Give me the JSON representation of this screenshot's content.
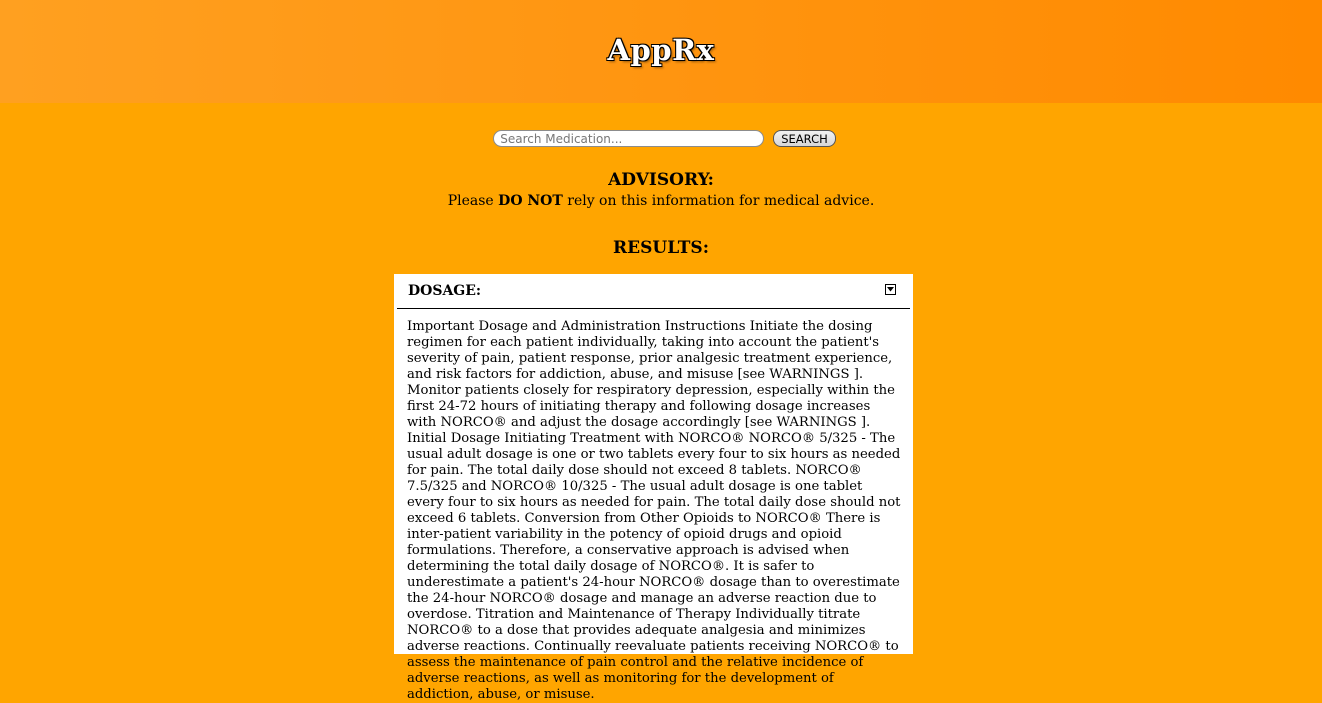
{
  "app": {
    "title": "AppRx"
  },
  "search": {
    "placeholder": "Search Medication...",
    "value": "",
    "button_label": "SEARCH"
  },
  "advisory": {
    "heading": "ADVISORY:",
    "text_before": "Please ",
    "text_bold": "DO NOT",
    "text_after": " rely on this information for medical advice."
  },
  "results": {
    "heading": "RESULTS:",
    "section": {
      "title": "DOSAGE:",
      "toggle_icon": "chevron-down-icon",
      "body": "Important Dosage and Administration Instructions Initiate the dosing regimen for each patient individually, taking into account the patient's severity of pain, patient response, prior analgesic treatment experience, and risk factors for addiction, abuse, and misuse [see WARNINGS ]. Monitor patients closely for respiratory depression, especially within the first 24-72 hours of initiating therapy and following dosage increases with NORCO® and adjust the dosage accordingly [see WARNINGS ]. Initial Dosage Initiating Treatment with NORCO® NORCO® 5/325 - The usual adult dosage is one or two tablets every four to six hours as needed for pain. The total daily dose should not exceed 8 tablets. NORCO® 7.5/325 and NORCO® 10/325 - The usual adult dosage is one tablet every four to six hours as needed for pain. The total daily dose should not exceed 6 tablets. Conversion from Other Opioids to NORCO® There is inter-patient variability in the potency of opioid drugs and opioid formulations. Therefore, a conservative approach is advised when determining the total daily dosage of NORCO®. It is safer to underestimate a patient's 24-hour NORCO® dosage than to overestimate the 24-hour NORCO® dosage and manage an adverse reaction due to overdose. Titration and Maintenance of Therapy Individually titrate NORCO® to a dose that provides adequate analgesia and minimizes adverse reactions. Continually reevaluate patients receiving NORCO® to assess the maintenance of pain control and the relative incidence of adverse reactions, as well as monitoring for the development of addiction, abuse, or misuse."
    }
  },
  "colors": {
    "header_bg": "#ff8a00",
    "page_bg": "#ffa500",
    "panel_bg": "#ffffff"
  }
}
